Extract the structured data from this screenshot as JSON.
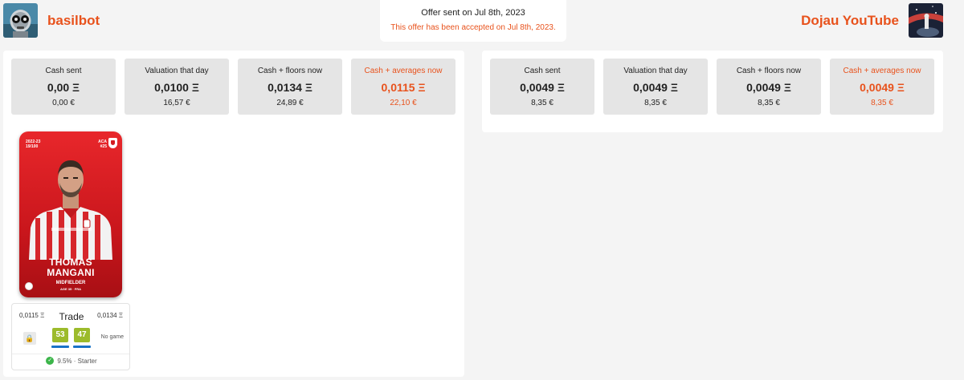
{
  "offer": {
    "sent": "Offer sent on Jul 8th, 2023",
    "accepted": "This offer has been accepted on Jul 8th, 2023."
  },
  "left_user": {
    "name": "basilbot",
    "stats": [
      {
        "label": "Cash sent",
        "value": "0,00 Ξ",
        "eur": "0,00 €"
      },
      {
        "label": "Valuation that day",
        "value": "0,0100 Ξ",
        "eur": "16,57 €"
      },
      {
        "label": "Cash + floors now",
        "value": "0,0134 Ξ",
        "eur": "24,89 €"
      },
      {
        "label": "Cash + averages now",
        "value": "0,0115 Ξ",
        "eur": "22,10 €"
      }
    ],
    "card": {
      "season": "2022-23",
      "serial": "19/100",
      "club": "ACA",
      "number": "#25",
      "first_name": "THOMAS",
      "last_name": "MANGANI",
      "position": "MIDFIELDER",
      "age": "AGE 35 · FRA"
    },
    "trade": {
      "left_price": "0,0115 Ξ",
      "title": "Trade",
      "right_price": "0,0134 Ξ",
      "score1": "53",
      "score2": "47",
      "no_game": "No game",
      "status": "9.5% · Starter"
    }
  },
  "right_user": {
    "name": "Dojau YouTube",
    "stats": [
      {
        "label": "Cash sent",
        "value": "0,0049 Ξ",
        "eur": "8,35 €"
      },
      {
        "label": "Valuation that day",
        "value": "0,0049 Ξ",
        "eur": "8,35 €"
      },
      {
        "label": "Cash + floors now",
        "value": "0,0049 Ξ",
        "eur": "8,35 €"
      },
      {
        "label": "Cash + averages now",
        "value": "0,0049 Ξ",
        "eur": "8,35 €"
      }
    ]
  },
  "colors": {
    "accent": "#e8521c",
    "score_green": "#9cbb2b",
    "card_red": "#d31b20",
    "bar_blue": "#1a73c8"
  },
  "icons": [
    "robot-avatar-icon",
    "lock-icon",
    "check-circle-icon",
    "ball-icon",
    "club-crest-icon"
  ]
}
